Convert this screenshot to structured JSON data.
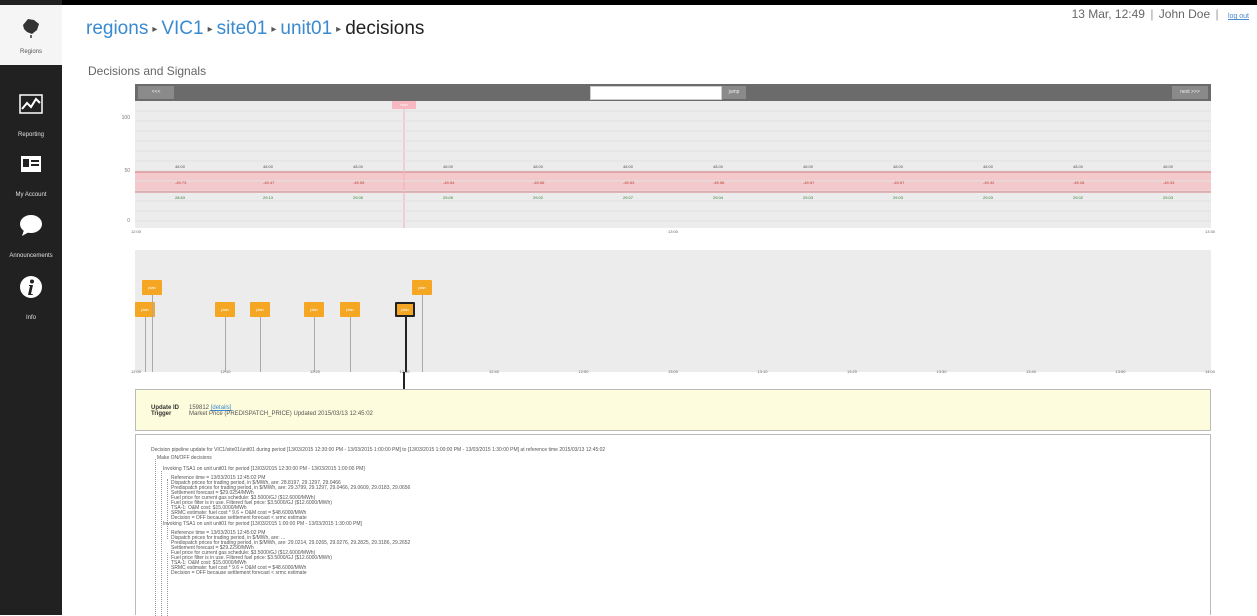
{
  "sidebar": {
    "items": [
      {
        "label": "Regions",
        "icon": "map-icon"
      },
      {
        "label": "Reporting",
        "icon": "line-chart-icon"
      },
      {
        "label": "My Account",
        "icon": "id-card-icon"
      },
      {
        "label": "Announcements",
        "icon": "speech-bubble-icon"
      },
      {
        "label": "Info",
        "icon": "info-icon"
      }
    ]
  },
  "header": {
    "datetime": "13 Mar, 12:49",
    "user": "John Doe",
    "logout": "log out"
  },
  "breadcrumb": {
    "items": [
      "regions",
      "VIC1",
      "site01",
      "unit01"
    ],
    "current": "decisions"
  },
  "section_title": "Decisions and Signals",
  "signal_chart": {
    "prev": "<<<",
    "next": "next >>>",
    "jump": "jump",
    "now_tag": "now",
    "yticks": [
      "100",
      "50",
      "0"
    ],
    "xticks": [
      "12:00",
      "13:00",
      "13:30"
    ],
    "rows": {
      "top": [
        "48.00",
        "48.00",
        "48.00",
        "48.00",
        "48.00",
        "48.00",
        "48.00",
        "48.00",
        "48.00",
        "48.00",
        "48.00",
        "48.00"
      ],
      "mid": [
        "-49.73",
        "-49.47",
        "-49.55",
        "-49.54",
        "-49.56",
        "-49.53",
        "-49.56",
        "-49.57",
        "-49.57",
        "-49.32",
        "-49.28",
        "-49.33"
      ],
      "bot": [
        "28.63",
        "29.13",
        "29.05",
        "29.09",
        "29.02",
        "29.07",
        "29.04",
        "29.03",
        "29.03",
        "29.03",
        "29.02",
        "29.03"
      ]
    }
  },
  "plan_chart": {
    "marker": "plan",
    "xticks": [
      "12:00",
      "12:10",
      "12:20",
      "12:30",
      "12:40",
      "12:50",
      "13:00",
      "13:10",
      "13:20",
      "13:30",
      "13:40",
      "13:50",
      "14:00"
    ]
  },
  "update": {
    "id_label": "Update ID",
    "id_value": "159812",
    "details": "[details]",
    "trigger_label": "Trigger",
    "trigger_value": "Market Price (PREDISPATCH_PRICE) Updated 2015/03/13 12:45:02"
  },
  "log": [
    "Decision pipeline update for VIC1/site01/unit01 during period [13/03/2015 12:30:00 PM - 13/03/2015 1:00:00 PM] to [13/03/2015 1:00:00 PM - 13/03/2015 1:30:00 PM] at reference time 2015/03/13 12:45:02",
    "Make ON/OFF decisions",
    "Invoking TSA1 on unit unit01 for period [13/03/2015 12:30:00 PM - 13/03/2015 1:00:00 PM]",
    "Reference time = 13/03/2015 12:45:02 PM",
    "Dispatch prices for trading period, in $/MWh, are: 28.8197, 29.1297, 29.0466",
    "Predispatch prices for trading period, in $/MWh, are: 29.3799, 29.1297, 29.0466, 29.0609, 29.0183, 29.0656",
    "Settlement forecast = $29.0254/MWh",
    "Fuel price for current gas schedule: $3.5000/GJ ($12.6000/MWh)",
    "Fuel price filter is in use. Filtered fuel price: $3.5000/GJ ($12.6000/MWh)",
    "TSA-1: O&M cost: $15.0000/MWh",
    "SRMC estimate: fuel cost * 9.6 + O&M cost = $48.6000/MWh",
    "Decision = OFF because settlement forecast < srmc estimate",
    "Invoking TSA1 on unit unit01 for period [13/03/2015 1:00:00 PM - 13/03/2015 1:30:00 PM]",
    "Reference time = 13/03/2015 12:45:02 PM",
    "Dispatch prices for trading period, in $/MWh, are: ...",
    "Predispatch prices for trading period, in $/MWh, are: 29.0214, 29.0265, 29.0276, 29.2825, 29.3186, 29.2652",
    "Settlement forecast = $29.2290/MWh",
    "Fuel price for current gas schedule: $3.5000/GJ ($12.6000/MWh)",
    "Fuel price filter is in use. Filtered fuel price: $3.5000/GJ ($12.6000/MWh)",
    "TSA-1: O&M cost: $15.0000/MWh",
    "SRMC estimate: fuel cost * 9.6 + O&M cost = $48.6000/MWh",
    "Decision = OFF because settlement forecast < srmc estimate"
  ],
  "colors": {
    "accent": "#3a8ad1",
    "plan": "#f5a623",
    "band": "#f3c9cc"
  }
}
